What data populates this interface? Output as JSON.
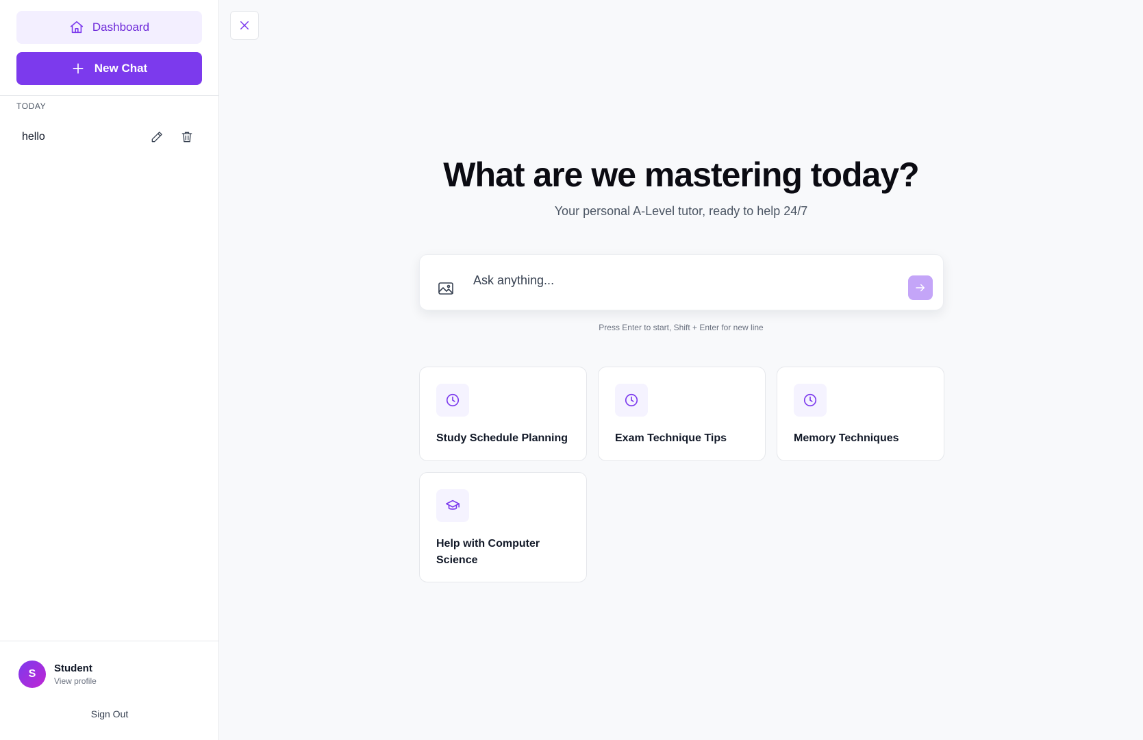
{
  "sidebar": {
    "dashboard_label": "Dashboard",
    "new_chat_label": "New Chat",
    "section_label": "TODAY",
    "chats": [
      {
        "title": "hello"
      }
    ],
    "profile": {
      "initial": "S",
      "name": "Student",
      "subtitle": "View profile"
    },
    "sign_out_label": "Sign Out"
  },
  "main": {
    "headline": "What are we mastering today?",
    "subheadline": "Your personal A-Level tutor, ready to help 24/7",
    "input": {
      "placeholder": "Ask anything...",
      "value": ""
    },
    "hint": "Press Enter to start, Shift + Enter for new line",
    "suggestions": [
      {
        "label": "Study Schedule Planning",
        "icon": "clock-icon"
      },
      {
        "label": "Exam Technique Tips",
        "icon": "clock-icon"
      },
      {
        "label": "Memory Techniques",
        "icon": "clock-icon"
      },
      {
        "label": "Help with Computer Science",
        "icon": "graduation-cap-icon"
      }
    ]
  },
  "colors": {
    "accent": "#7c3aed",
    "accent_light": "#f3efff",
    "send_button": "#c4a5f8",
    "background": "#f8f9fb"
  }
}
